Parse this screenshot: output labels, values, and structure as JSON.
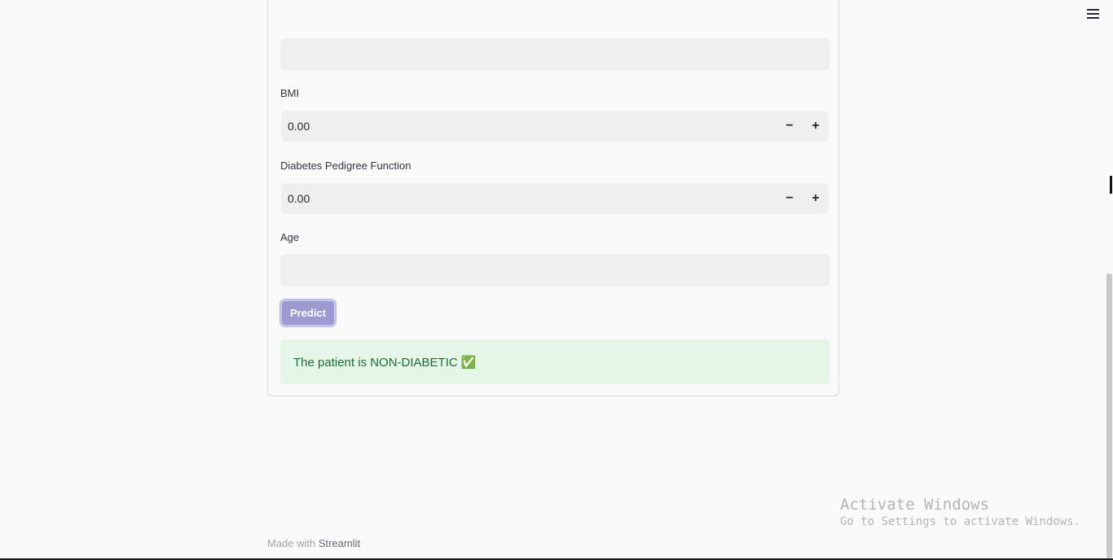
{
  "menu": {
    "icon": "hamburger-menu-icon"
  },
  "form": {
    "fields": [
      {
        "label": "BMI",
        "value": "0.00",
        "decrement": "−",
        "increment": "+"
      },
      {
        "label": "Diabetes Pedigree Function",
        "value": "0.00",
        "decrement": "−",
        "increment": "+"
      },
      {
        "label": "Age",
        "value": ""
      }
    ],
    "predict_label": "Predict",
    "result_text": "The patient is NON-DIABETIC ✅"
  },
  "footer": {
    "prefix": "Made with",
    "brand": "Streamlit"
  },
  "watermark": {
    "title": "Activate Windows",
    "subtitle": "Go to Settings to activate Windows."
  },
  "colors": {
    "accent": "#9b9bd2",
    "success_bg": "#e5f6e8",
    "success_text": "#1c6b35"
  }
}
